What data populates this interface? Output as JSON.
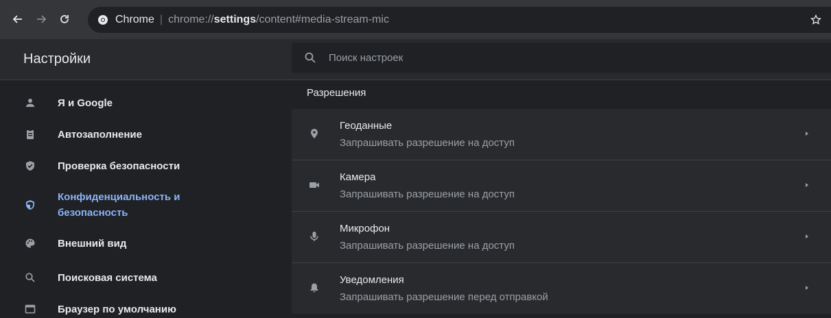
{
  "browser": {
    "site_name": "Chrome",
    "url_prefix": "chrome://",
    "url_bold": "settings",
    "url_rest": "/content#media-stream-mic"
  },
  "header": {
    "title": "Настройки",
    "search_placeholder": "Поиск настроек"
  },
  "sidebar": {
    "items": [
      {
        "label": "Я и Google",
        "icon": "person-icon"
      },
      {
        "label": "Автозаполнение",
        "icon": "clipboard-icon"
      },
      {
        "label": "Проверка безопасности",
        "icon": "shield-check-icon"
      },
      {
        "label_line1": "Конфиденциальность и",
        "label_line2": "безопасность",
        "icon": "shield-half-icon",
        "active": true
      },
      {
        "label": "Внешний вид",
        "icon": "palette-icon"
      },
      {
        "label": "Поисковая система",
        "icon": "search-icon"
      },
      {
        "label": "Браузер по умолчанию",
        "icon": "browser-window-icon"
      }
    ]
  },
  "main": {
    "section_title": "Разрешения",
    "permissions": [
      {
        "title": "Геоданные",
        "subtitle": "Запрашивать разрешение на доступ",
        "icon": "location-pin-icon"
      },
      {
        "title": "Камера",
        "subtitle": "Запрашивать разрешение на доступ",
        "icon": "videocam-icon"
      },
      {
        "title": "Микрофон",
        "subtitle": "Запрашивать разрешение на доступ",
        "icon": "mic-icon"
      },
      {
        "title": "Уведомления",
        "subtitle": "Запрашивать разрешение перед отправкой",
        "icon": "bell-icon"
      }
    ]
  },
  "colors": {
    "accent": "#8ab4f8",
    "background": "#202124",
    "surface": "#292a2d"
  }
}
